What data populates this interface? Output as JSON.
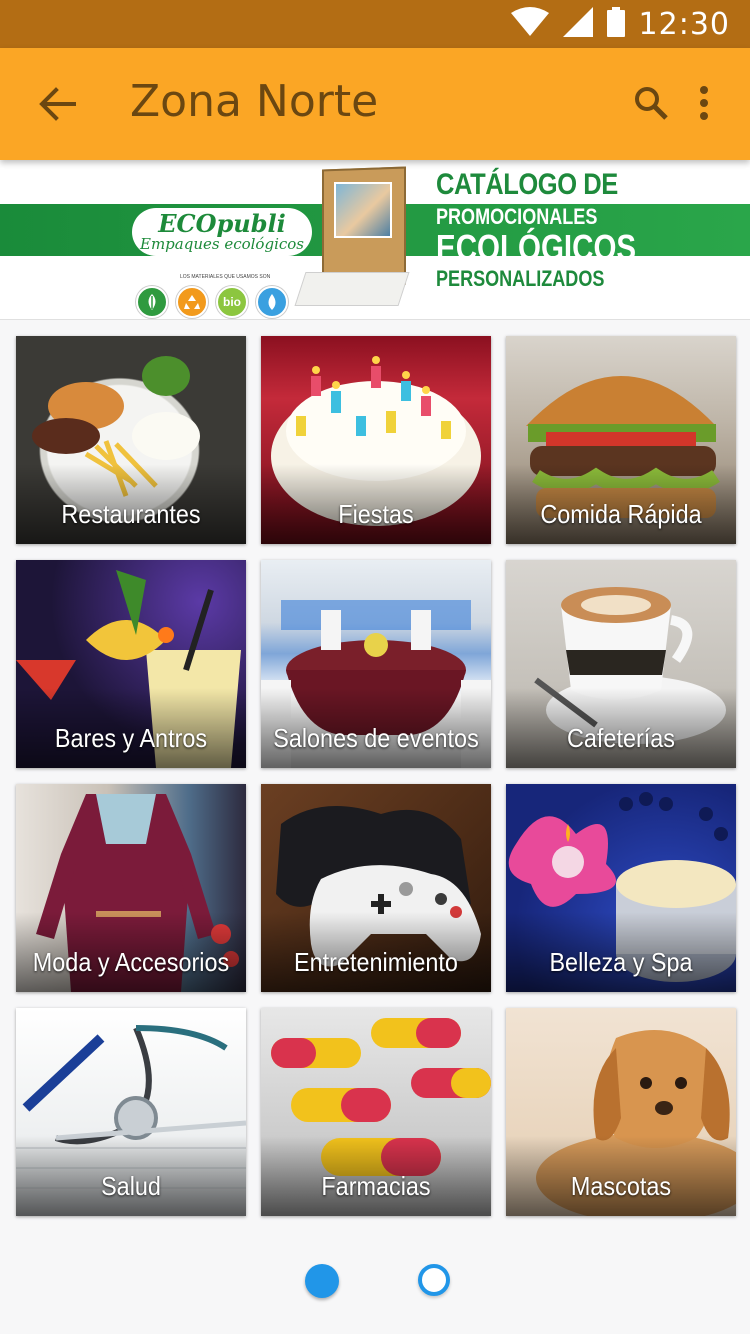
{
  "status_bar": {
    "time": "12:30",
    "icons": [
      "wifi-icon",
      "signal-icon",
      "battery-icon"
    ]
  },
  "app_bar": {
    "title": "Zona Norte",
    "back_icon": "arrow-back-icon",
    "search_icon": "search-icon",
    "more_icon": "more-vert-icon",
    "background": "#fba625",
    "title_color": "#6b4711"
  },
  "banner": {
    "logo_main": "ECOpubli",
    "logo_sub": "Empaques ecológicos",
    "small_note": "LOS MATERIALES QUE USAMOS SON",
    "badges": [
      "leaf",
      "recycle",
      "bio",
      "water"
    ],
    "badge_bio_label": "bio",
    "heading_line1": "CATÁLOGO DE",
    "heading_line2": "PROMOCIONALES",
    "heading_line3": "ECOLÓGICOS",
    "heading_line4": "PERSONALIZADOS",
    "accent": "#1e8a3c"
  },
  "categories": [
    {
      "label": "Restaurantes"
    },
    {
      "label": "Fiestas"
    },
    {
      "label": "Comida Rápida"
    },
    {
      "label": "Bares y Antros"
    },
    {
      "label": "Salones de eventos"
    },
    {
      "label": "Cafeterías"
    },
    {
      "label": "Moda y Accesorios"
    },
    {
      "label": "Entretenimiento"
    },
    {
      "label": "Belleza y Spa"
    },
    {
      "label": "Salud"
    },
    {
      "label": "Farmacias"
    },
    {
      "label": "Mascotas"
    }
  ],
  "pager": {
    "pages": 2,
    "current": 1,
    "accent": "#2196e8"
  }
}
